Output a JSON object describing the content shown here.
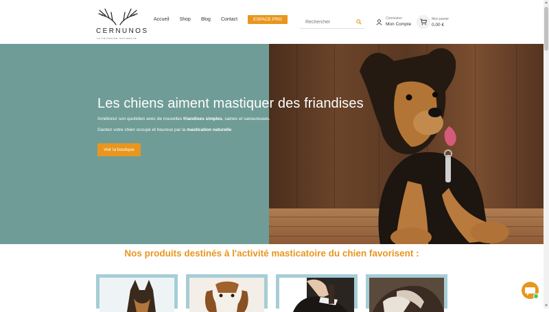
{
  "brand": {
    "name": "CERNUNOS",
    "tagline": "LA FRIANDISE NATURELLE",
    "accent": "#e8961e",
    "hero_bg": "#6f9c96"
  },
  "nav": {
    "items": [
      "Accueil",
      "Shop",
      "Blog",
      "Contact"
    ],
    "pro_label": "ESPACE PRO"
  },
  "search": {
    "placeholder": "Rechercher",
    "icon": "search-icon"
  },
  "account": {
    "top": "Connexion",
    "label": "Mon Compte",
    "icon": "user-icon"
  },
  "cart": {
    "top": "Mon panier",
    "amount": "0,00 €",
    "icon": "cart-icon"
  },
  "hero": {
    "title": "Les chiens aiment mastiquer des friandises",
    "p1_a": "Améliorez son quotidien avec de nouvelles ",
    "p1_b": "friandises simples",
    "p1_c": ", saines et savoureuses.",
    "p2_a": "Gardez votre chien occupé et heureux par la ",
    "p2_b": "mastication naturelle",
    "p2_c": ".",
    "cta": "Voir la boutique"
  },
  "products": {
    "title": "Nos produits destinés à l'activité masticatoire du chien favorisent :"
  }
}
